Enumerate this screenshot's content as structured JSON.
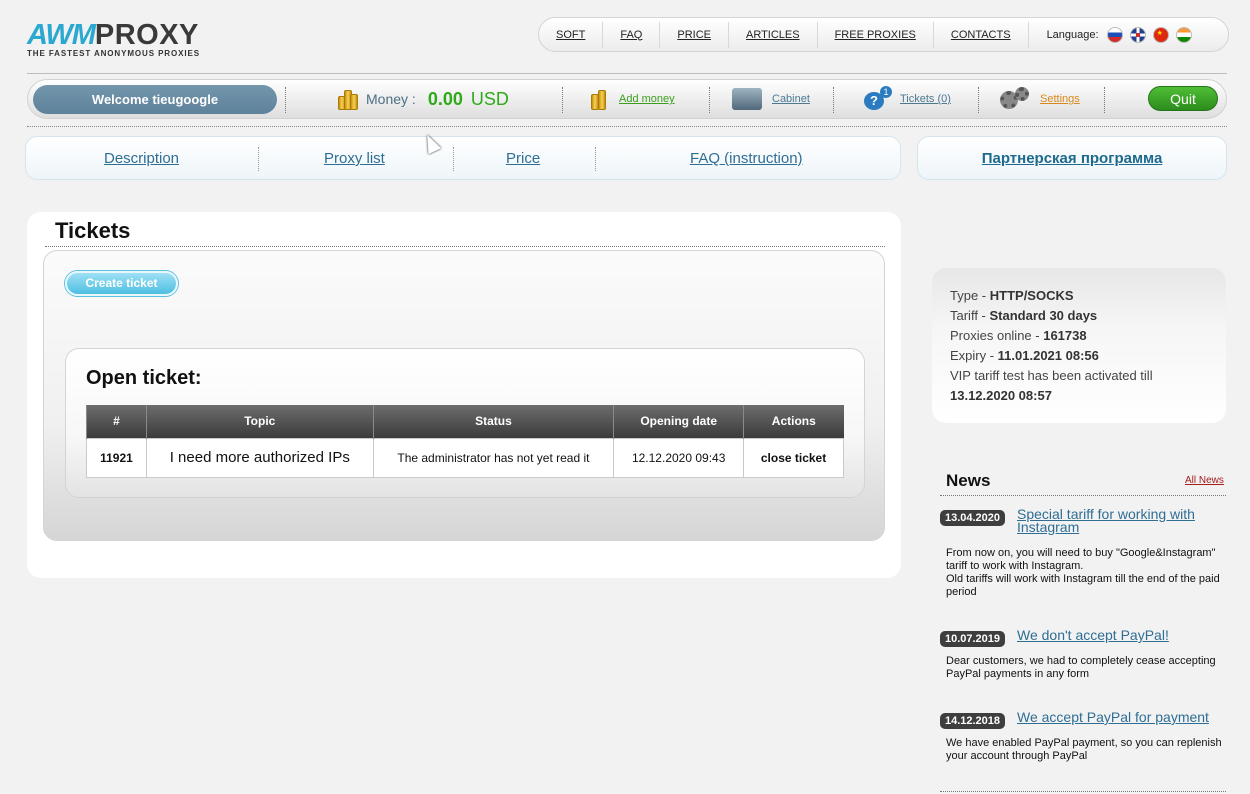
{
  "logo": {
    "brand_a": "AWM",
    "brand_b": "PROXY",
    "tagline": "THE FASTEST ANONYMOUS PROXIES"
  },
  "topnav": {
    "items": [
      "SOFT",
      "FAQ",
      "PRICE",
      "ARTICLES",
      "FREE PROXIES",
      "CONTACTS"
    ],
    "language_label": "Language:",
    "flags": [
      "flag-ru-icon",
      "flag-uk-icon",
      "flag-cn-icon",
      "flag-in-icon"
    ]
  },
  "userbar": {
    "welcome": "Welcome tieugoogle",
    "money_label": "Money :",
    "money_value": "0.00",
    "money_currency": "USD",
    "add_money": "Add money",
    "cabinet": "Cabinet",
    "tickets": "Tickets (0)",
    "tickets_badge": "1",
    "settings": "Settings",
    "quit": "Quit",
    "colors": {
      "money": "#2faa1a",
      "add_money": "#3b9f1d",
      "settings": "#d9891b",
      "quit": "#3aa726"
    }
  },
  "subnav": {
    "items": [
      "Description",
      "Proxy list",
      "Price",
      "FAQ (instruction)"
    ],
    "partner": "Партнерская программа"
  },
  "main": {
    "title": "Tickets",
    "create_button": "Create ticket",
    "open_title": "Open ticket:",
    "table": {
      "headers": [
        "#",
        "Topic",
        "Status",
        "Opening date",
        "Actions"
      ],
      "rows": [
        [
          "11921",
          "I need more authorized IPs",
          "The administrator has not yet read it",
          "12.12.2020 09:43",
          "close ticket"
        ]
      ]
    }
  },
  "sidebar": {
    "info": {
      "type_label": "Type - ",
      "type_value": "HTTP/SOCKS",
      "tariff_label": "Tariff - ",
      "tariff_value": "Standard 30 days",
      "online_label": "Proxies online - ",
      "online_value": "161738",
      "expiry_label": "Expiry - ",
      "expiry_value": "11.01.2021 08:56",
      "vip_text": "VIP tariff test has been activated till",
      "vip_value": "13.12.2020 08:57"
    },
    "news_title": "News",
    "all_news": "All News",
    "news": [
      {
        "date": "13.04.2020",
        "title": "Special tariff for working with Instagram",
        "text": "From now on, you will need to buy \"Google&Instagram\" tariff to work with Instagram.\nOld tariffs will work with Instagram till the end of the paid period"
      },
      {
        "date": "10.07.2019",
        "title": "We don't accept PayPal!",
        "text": "Dear customers, we had to completely cease accepting PayPal payments in any form"
      },
      {
        "date": "14.12.2018",
        "title": "We accept PayPal for payment",
        "text": "We have enabled PayPal payment, so you can replenish your account through PayPal"
      }
    ]
  }
}
